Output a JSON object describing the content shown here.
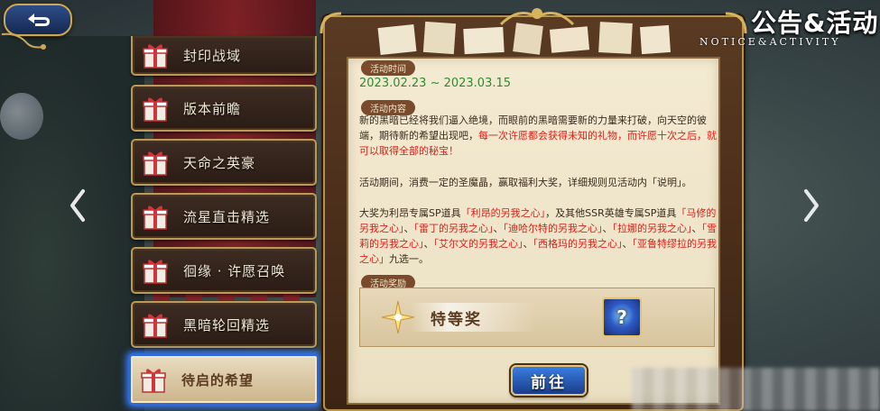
{
  "header": {
    "back_icon": "return-arrow-icon",
    "title_cn": "公告&活动",
    "title_en": "NOTICE&ACTIVITY"
  },
  "menu": {
    "items": [
      {
        "label": "封印战域",
        "icon": "gift-box-icon"
      },
      {
        "label": "版本前瞻",
        "icon": "gift-box-icon"
      },
      {
        "label": "天命之英豪",
        "icon": "gift-box-icon"
      },
      {
        "label": "流星直击精选",
        "icon": "gift-box-icon"
      },
      {
        "label": "徊缘 · 许愿召唤",
        "icon": "gift-box-icon"
      },
      {
        "label": "黑暗轮回精选",
        "icon": "gift-box-icon"
      },
      {
        "label": "待启的希望",
        "icon": "gift-box-icon",
        "selected": true
      }
    ]
  },
  "navigation": {
    "prev_icon": "chevron-left-icon",
    "next_icon": "chevron-right-icon"
  },
  "notice": {
    "time_tag": "活动时间",
    "date_range": "2023.02.23 ~ 2023.03.15",
    "content_tag": "活动内容",
    "paragraph1_a": "新的黑暗已经将我们逼入绝境，而眼前的黑暗需要新的力量来打破，向天空的彼端，期待新的希望出现吧，",
    "paragraph1_b": "每一次许愿都会获得未知的礼物，而许愿十次之后，就可以取得全部的秘宝！",
    "paragraph2": "活动期间，消费一定的圣魔晶，赢取福利大奖，详细规则见活动内「说明」。",
    "paragraph3_a": "大奖为利昂专属SP道具",
    "paragraph3_b": "「利昂的另我之心」",
    "paragraph3_c": "，及其他SSR英雄专属SP道具",
    "paragraph3_items": [
      "「马修的另我之心」",
      "「雷丁的另我之心」",
      "「迪哈尔特的另我之心」",
      "「拉娜的另我之心」",
      "「雪莉的另我之心」",
      "「艾尔文的另我之心」",
      "「西格玛的另我之心」",
      "「亚鲁特缪拉的另我之心」"
    ],
    "paragraph3_sep": "、",
    "paragraph3_end": "九选一。",
    "reward_tag": "活动奖励",
    "reward_name": "特等奖",
    "reward_item_icon": "question-mark-orb-icon",
    "reward_item_glyph": "?"
  },
  "actions": {
    "go_label": "前往"
  },
  "colors": {
    "highlight_red": "#d4221a",
    "date_green": "#2e8a2e",
    "selection_blue": "#2f6ad8"
  }
}
